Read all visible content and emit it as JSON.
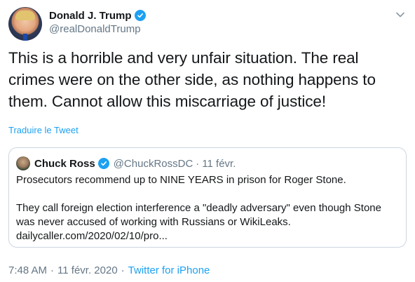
{
  "author": {
    "display_name": "Donald J. Trump",
    "handle": "@realDonaldTrump",
    "verified": true
  },
  "tweet": {
    "text": "This is a horrible and very unfair situation. The real crimes were on the other side, as nothing happens to them. Cannot allow this miscarriage of justice!",
    "translate_label": "Traduire le Tweet"
  },
  "quoted": {
    "display_name": "Chuck Ross",
    "handle": "@ChuckRossDC",
    "separator": "·",
    "date": "11 févr.",
    "verified": true,
    "paragraph1": "Prosecutors recommend up to NINE YEARS in prison for Roger Stone.",
    "paragraph2": "They call foreign election interference a \"deadly adversary\" even though Stone was never accused of working with Russians or WikiLeaks. dailycaller.com/2020/02/10/pro..."
  },
  "meta": {
    "time": "7:48 AM",
    "separator": "·",
    "date": "11 févr. 2020",
    "source": "Twitter for iPhone"
  },
  "colors": {
    "accent": "#1da1f2",
    "text": "#14171a",
    "secondary": "#657786",
    "border": "#ccd6dd"
  },
  "icons": {
    "verified": "verified-badge-icon",
    "menu": "chevron-down-icon"
  }
}
